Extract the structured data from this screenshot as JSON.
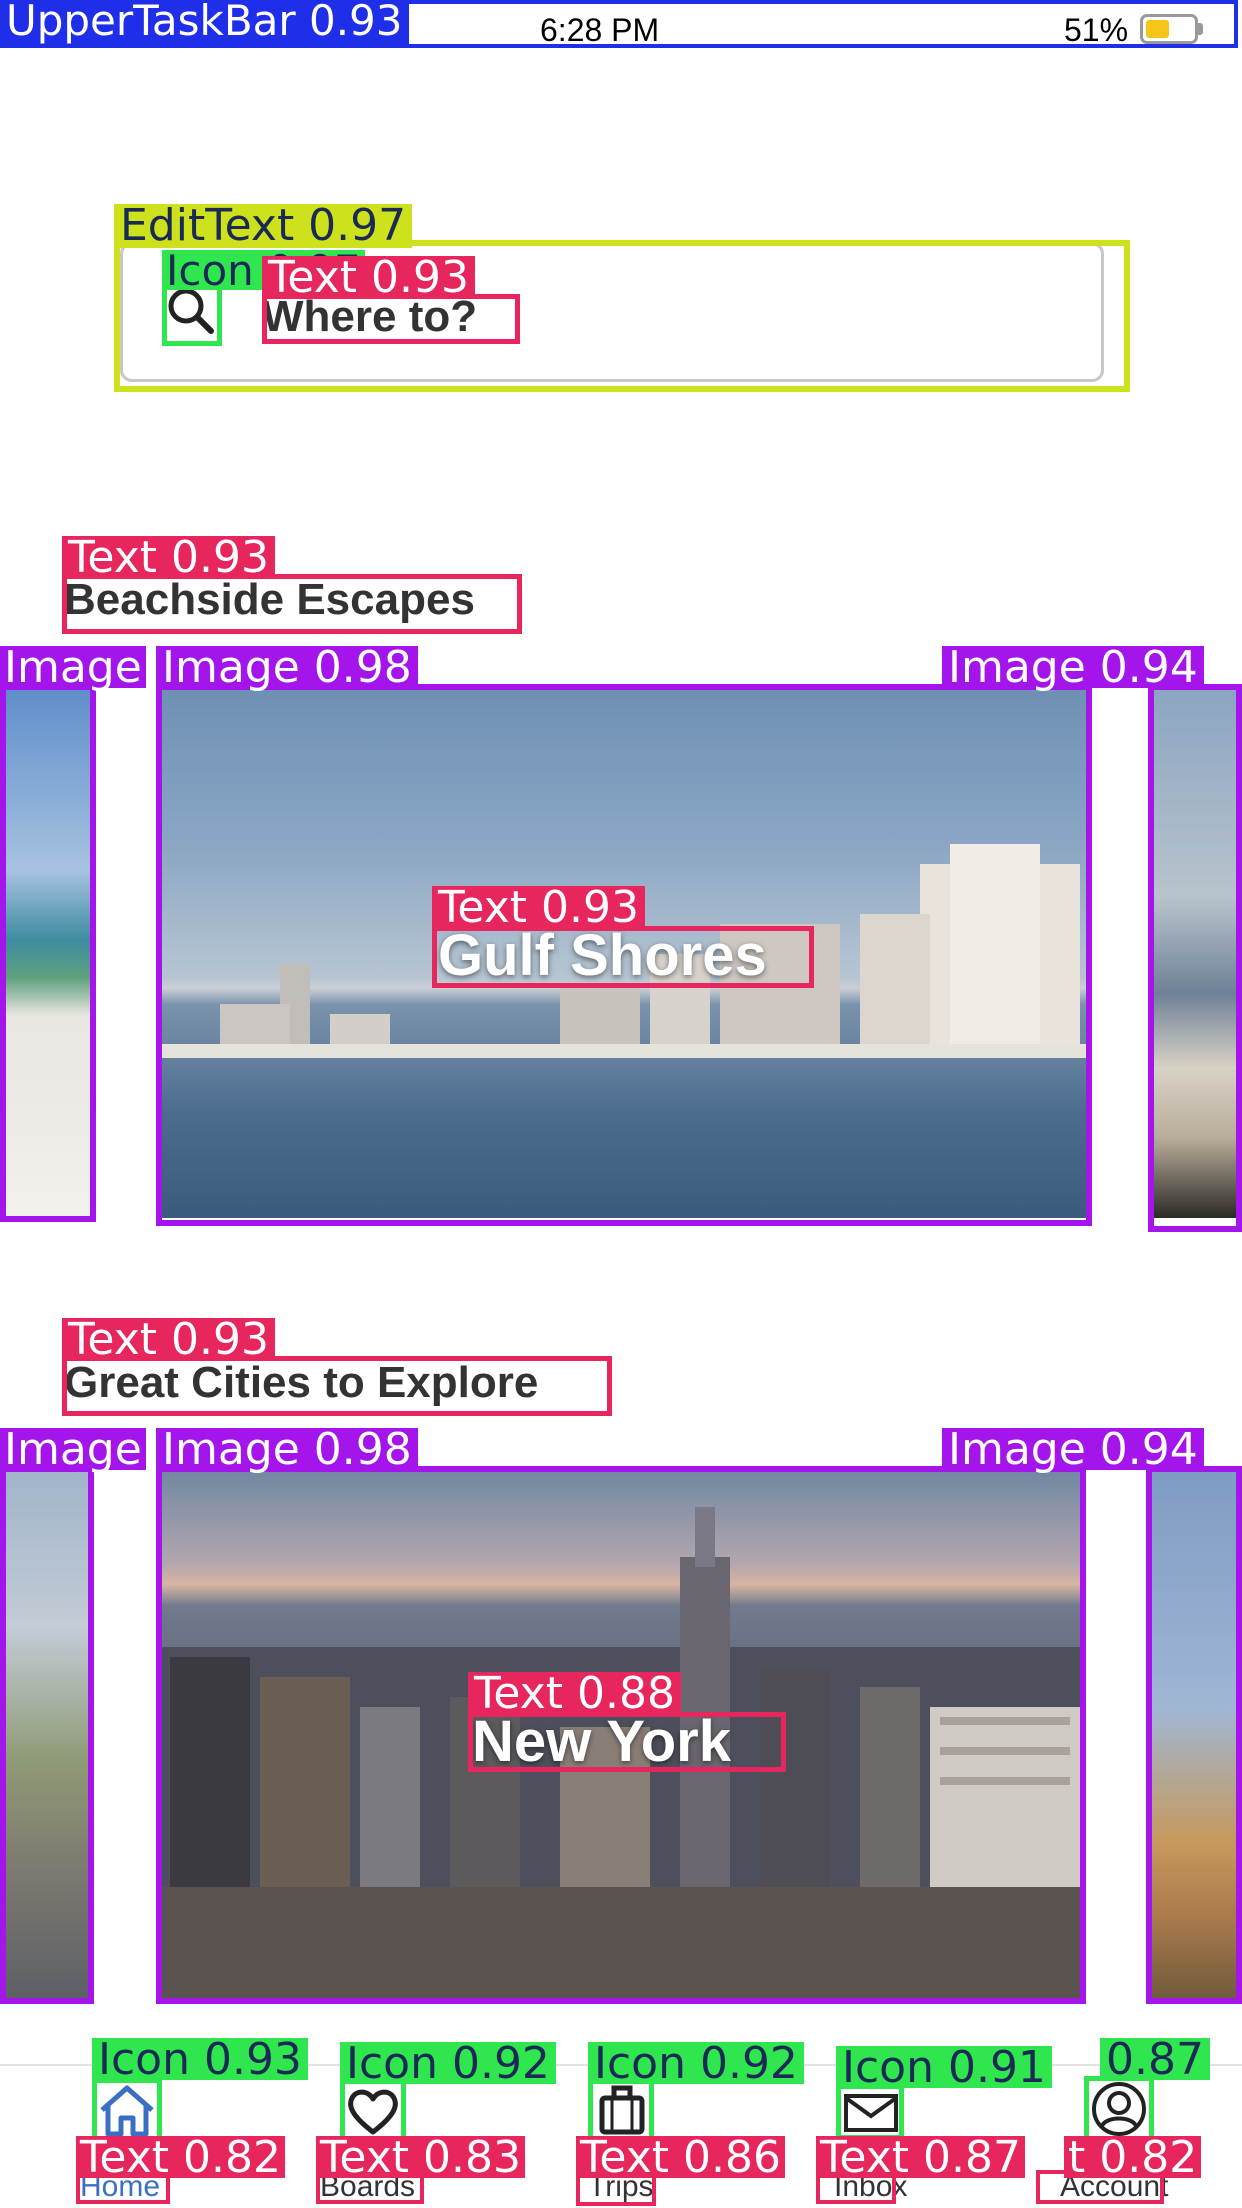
{
  "status_bar": {
    "time": "6:28 PM",
    "battery_percent": "51%",
    "battery_level": 0.51,
    "battery_color": "#f5c518"
  },
  "search": {
    "icon": "search-icon",
    "placeholder": "Where to?"
  },
  "sections": [
    {
      "title": "Beachside Escapes",
      "cards": [
        {
          "label": ""
        },
        {
          "label": "Gulf Shores"
        },
        {
          "label": ""
        }
      ]
    },
    {
      "title": "Great Cities to Explore",
      "cards": [
        {
          "label": ""
        },
        {
          "label": "New York"
        },
        {
          "label": ""
        }
      ]
    }
  ],
  "tab_bar": {
    "active_color": "#3b6fc4",
    "items": [
      {
        "label": "Home",
        "icon": "home-icon",
        "active": true
      },
      {
        "label": "Boards",
        "icon": "heart-icon",
        "active": false
      },
      {
        "label": "Trips",
        "icon": "suitcase-icon",
        "active": false
      },
      {
        "label": "Inbox",
        "icon": "mail-icon",
        "active": false
      },
      {
        "label": "Account",
        "icon": "account-icon",
        "active": false
      }
    ]
  },
  "annotations": {
    "upper_task_bar": "UpperTaskBar 0.93",
    "edit_text": "EditText 0.97",
    "search_icon": "Icon 0.97",
    "search_text": "Text 0.93",
    "beach_title": "Text 0.93",
    "beach_img_left": "Image",
    "beach_img_main": "Image 0.98",
    "beach_img_right": "Image 0.94",
    "beach_label": "Text 0.93",
    "city_title": "Text 0.93",
    "city_img_left": "Image",
    "city_img_main": "Image 0.98",
    "city_img_right": "Image 0.94",
    "city_label": "Text 0.88",
    "tab_icons": [
      "Icon 0.93",
      "Icon 0.92",
      "Icon 0.92",
      "Icon 0.91",
      "0.87"
    ],
    "tab_texts": [
      "Text 0.82",
      "Text 0.83",
      "Text 0.86",
      "Text 0.87",
      "t 0.82"
    ],
    "colors": {
      "task_bar": "#1f2ee8",
      "edit_text": "#cde21c",
      "icon": "#2fe64e",
      "text": "#e8265e",
      "image": "#a315ea"
    }
  }
}
